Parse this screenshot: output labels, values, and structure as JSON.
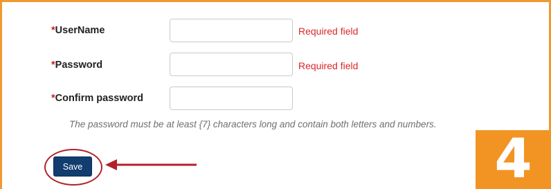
{
  "form": {
    "fields": [
      {
        "required_mark": "*",
        "label": "UserName",
        "value": "",
        "error": "Required field"
      },
      {
        "required_mark": "*",
        "label": "Password",
        "value": "",
        "error": "Required field"
      },
      {
        "required_mark": "*",
        "label": "Confirm password",
        "value": "",
        "error": ""
      }
    ],
    "password_hint": "The password must be at least {7} characters long and contain both letters and numbers.",
    "save_label": "Save"
  },
  "annotation": {
    "step_number": "4",
    "highlight_color": "#b0232a",
    "badge_color": "#f29423",
    "frame_color": "#ef9a2e"
  }
}
